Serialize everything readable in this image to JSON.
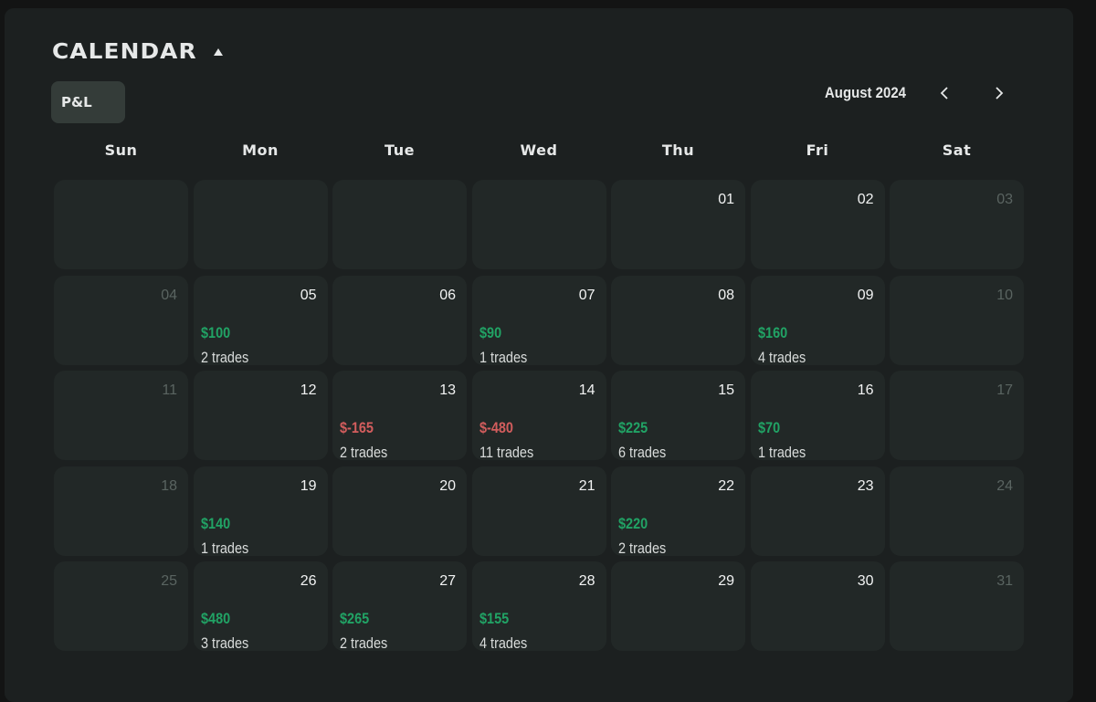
{
  "header": {
    "title": "CALENDAR",
    "collapse_icon": "triangle-up-icon",
    "filter_button_label": "P&L"
  },
  "nav": {
    "month_label": "August 2024",
    "prev_icon": "chevron-left-icon",
    "next_icon": "chevron-right-icon"
  },
  "colors": {
    "positive": "#21a365",
    "negative": "#d35d5d",
    "panel_bg": "#1c2020",
    "cell_bg": "#222827",
    "dim_date": "#5a6461"
  },
  "weekdays": [
    "Sun",
    "Mon",
    "Tue",
    "Wed",
    "Thu",
    "Fri",
    "Sat"
  ],
  "days": [
    {
      "date": ""
    },
    {
      "date": ""
    },
    {
      "date": ""
    },
    {
      "date": ""
    },
    {
      "date": "01"
    },
    {
      "date": "02"
    },
    {
      "date": "03",
      "weekend": true
    },
    {
      "date": "04",
      "weekend": true
    },
    {
      "date": "05",
      "pnl": "$100",
      "trades": "2 trades",
      "sign": "pos"
    },
    {
      "date": "06"
    },
    {
      "date": "07",
      "pnl": "$90",
      "trades": "1 trades",
      "sign": "pos"
    },
    {
      "date": "08"
    },
    {
      "date": "09",
      "pnl": "$160",
      "trades": "4 trades",
      "sign": "pos"
    },
    {
      "date": "10",
      "weekend": true
    },
    {
      "date": "11",
      "weekend": true
    },
    {
      "date": "12"
    },
    {
      "date": "13",
      "pnl": "$-165",
      "trades": "2 trades",
      "sign": "neg"
    },
    {
      "date": "14",
      "pnl": "$-480",
      "trades": "11 trades",
      "sign": "neg"
    },
    {
      "date": "15",
      "pnl": "$225",
      "trades": "6 trades",
      "sign": "pos"
    },
    {
      "date": "16",
      "pnl": "$70",
      "trades": "1 trades",
      "sign": "pos"
    },
    {
      "date": "17",
      "weekend": true
    },
    {
      "date": "18",
      "weekend": true
    },
    {
      "date": "19",
      "pnl": "$140",
      "trades": "1 trades",
      "sign": "pos"
    },
    {
      "date": "20"
    },
    {
      "date": "21"
    },
    {
      "date": "22",
      "pnl": "$220",
      "trades": "2 trades",
      "sign": "pos"
    },
    {
      "date": "23"
    },
    {
      "date": "24",
      "weekend": true
    },
    {
      "date": "25",
      "weekend": true
    },
    {
      "date": "26",
      "pnl": "$480",
      "trades": "3 trades",
      "sign": "pos"
    },
    {
      "date": "27",
      "pnl": "$265",
      "trades": "2 trades",
      "sign": "pos"
    },
    {
      "date": "28",
      "pnl": "$155",
      "trades": "4 trades",
      "sign": "pos"
    },
    {
      "date": "29"
    },
    {
      "date": "30"
    },
    {
      "date": "31",
      "weekend": true
    }
  ]
}
